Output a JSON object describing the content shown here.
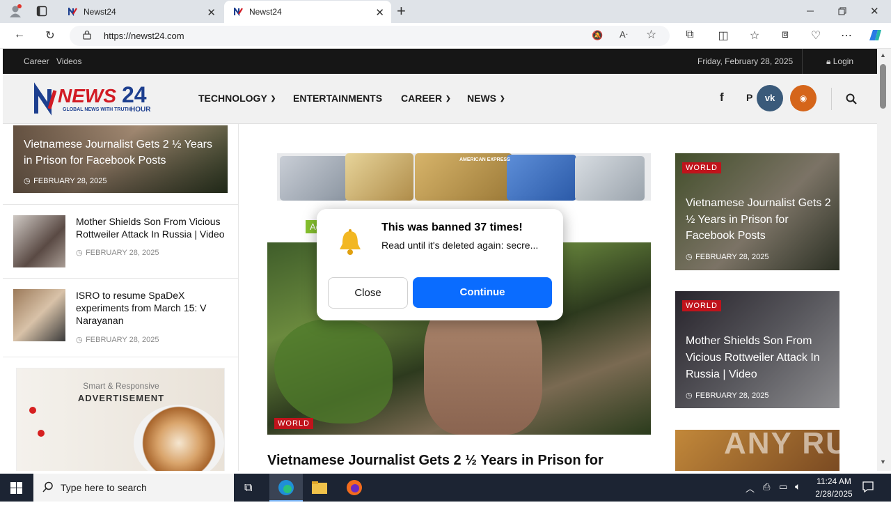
{
  "browser": {
    "tabs": [
      {
        "title": "Newst24",
        "active": false
      },
      {
        "title": "Newst24",
        "active": true
      }
    ],
    "new_tab_glyph": "+",
    "url": "https://newst24.com",
    "window_controls": [
      "minimize-icon",
      "restore-icon",
      "close-icon"
    ]
  },
  "site": {
    "topbar": {
      "links": [
        "Career",
        "Videos"
      ],
      "date": "Friday, February 28, 2025",
      "login": "Login"
    },
    "logo": {
      "word": "NEWS",
      "number": "24",
      "hour": "HOUR",
      "tagline": "GLOBAL NEWS WITH TRUTH"
    },
    "nav": [
      {
        "label": "TECHNOLOGY",
        "dropdown": true
      },
      {
        "label": "ENTERTAINMENTS",
        "dropdown": false
      },
      {
        "label": "CAREER",
        "dropdown": true
      },
      {
        "label": "NEWS",
        "dropdown": true
      }
    ],
    "social": [
      "facebook-icon",
      "pinterest-icon",
      "vk-icon",
      "rss-icon"
    ],
    "social_glyphs": {
      "facebook": "f",
      "pinterest": "P",
      "vk": "vk",
      "rss": "◉"
    },
    "colors": {
      "accent": "#c0131b",
      "vk": "#3a5a7a",
      "rss": "#d5651a",
      "button_blue": "#0a6cff"
    }
  },
  "sidebar": {
    "featured": {
      "title": "Vietnamese Journalist Gets 2 ½ Years in Prison for Facebook Posts",
      "date": "FEBRUARY 28, 2025"
    },
    "items": [
      {
        "title": "Mother Shields Son From Vicious Rottweiler Attack In Russia | Video",
        "date": "FEBRUARY 28, 2025"
      },
      {
        "title": "ISRO to resume SpaDeX experiments from March 15: V Narayanan",
        "date": "FEBRUARY 28, 2025"
      }
    ],
    "ad": {
      "line1": "Smart & Responsive",
      "line2": "ADVERTISEMENT"
    }
  },
  "main": {
    "banner_card_label": "AMERICAN EXPRESS",
    "hero": {
      "category": "WORLD",
      "title": "Vietnamese Journalist Gets 2 ½ Years in Prison for"
    }
  },
  "right": {
    "cards": [
      {
        "category": "WORLD",
        "title": "Vietnamese Journalist Gets 2 ½ Years in Prison for Facebook Posts",
        "date": "FEBRUARY 28, 2025"
      },
      {
        "category": "WORLD",
        "title": "Mother Shields Son From Vicious Rottweiler Attack In Russia | Video",
        "date": "FEBRUARY 28, 2025"
      }
    ]
  },
  "popup": {
    "ad_label": "Ad",
    "title": "This was banned 37 times!",
    "body": "Read until it's deleted again: secre...",
    "close_label": "Close",
    "continue_label": "Continue"
  },
  "watermark": "ANY RUN",
  "taskbar": {
    "search_placeholder": "Type here to search",
    "time": "11:24 AM",
    "date": "2/28/2025"
  }
}
